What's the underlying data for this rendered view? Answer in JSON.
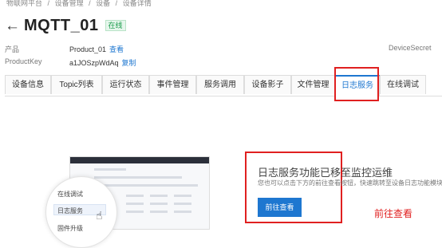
{
  "breadcrumb": [
    "物联网平台",
    "/",
    "设备管理",
    "/",
    "设备",
    "/",
    "设备详情"
  ],
  "header": {
    "back_icon": "arrow-left-icon",
    "title": "MQTT_01",
    "status_badge": "在线"
  },
  "info": {
    "product_label": "产品",
    "product_value": "Product_01",
    "product_link": "查看",
    "productkey_label": "ProductKey",
    "productkey_value": "a1JOSzpWdAq",
    "productkey_link": "复制",
    "devicesecret_label": "DeviceSecret"
  },
  "tabs": [
    {
      "label": "设备信息",
      "active": false
    },
    {
      "label": "Topic列表",
      "active": false
    },
    {
      "label": "运行状态",
      "active": false
    },
    {
      "label": "事件管理",
      "active": false
    },
    {
      "label": "服务调用",
      "active": false
    },
    {
      "label": "设备影子",
      "active": false
    },
    {
      "label": "文件管理",
      "active": false
    },
    {
      "label": "日志服务",
      "active": true
    },
    {
      "label": "在线调试",
      "active": false
    }
  ],
  "illustration": {
    "menu_items": [
      "在线调试",
      "日志服务",
      "固件升级"
    ],
    "cursor_icon": "hand-pointer-icon"
  },
  "notice": {
    "title": "日志服务功能已移至监控运维",
    "subtitle": "您也可以点击下方的前往查看按钮，快速跳转至设备日志功能模块",
    "button": "前往查看"
  },
  "annotation": "前往查看",
  "colors": {
    "accent": "#1e77d0",
    "highlight_red": "#e02020",
    "online_green": "#1a9c4b"
  }
}
